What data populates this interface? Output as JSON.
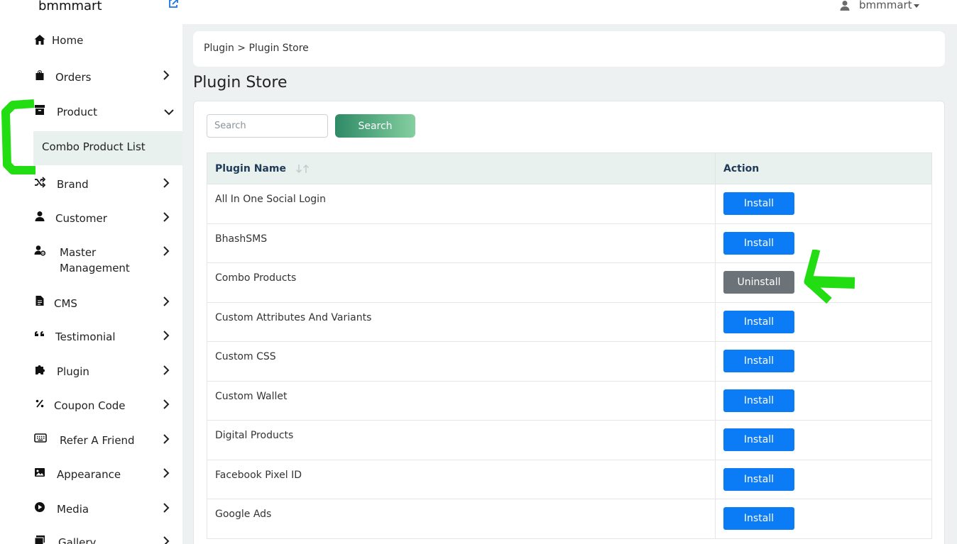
{
  "brand": {
    "name": "bmmmart"
  },
  "user": {
    "name": "bmmmart"
  },
  "sidebar": {
    "items": [
      {
        "label": "Home"
      },
      {
        "label": "Orders"
      },
      {
        "label": "Product"
      },
      {
        "label": "Brand"
      },
      {
        "label": "Customer"
      },
      {
        "label": "Master Management"
      },
      {
        "label": "CMS"
      },
      {
        "label": "Testimonial"
      },
      {
        "label": "Plugin"
      },
      {
        "label": "Coupon Code"
      },
      {
        "label": "Refer A Friend"
      },
      {
        "label": "Appearance"
      },
      {
        "label": "Media"
      },
      {
        "label": "Gallery"
      }
    ],
    "sub_item": {
      "label": "Combo Product List"
    }
  },
  "breadcrumb": {
    "text": "Plugin > Plugin Store"
  },
  "page": {
    "title": "Plugin Store"
  },
  "search": {
    "placeholder": "Search",
    "button": "Search"
  },
  "table": {
    "headers": [
      "Plugin Name",
      "Action"
    ],
    "rows": [
      {
        "name": "All In One Social Login",
        "action": "Install"
      },
      {
        "name": "BhashSMS",
        "action": "Install"
      },
      {
        "name": "Combo Products",
        "action": "Uninstall"
      },
      {
        "name": "Custom Attributes And Variants",
        "action": "Install"
      },
      {
        "name": "Custom CSS",
        "action": "Install"
      },
      {
        "name": "Custom Wallet",
        "action": "Install"
      },
      {
        "name": "Digital Products",
        "action": "Install"
      },
      {
        "name": "Facebook Pixel ID",
        "action": "Install"
      },
      {
        "name": "Google Ads",
        "action": "Install"
      }
    ]
  },
  "colors": {
    "accent_green": "#2e8a66",
    "install_blue": "#0b7bf6",
    "uninstall_gray": "#6b7278",
    "highlight_green": "#22dd11"
  }
}
